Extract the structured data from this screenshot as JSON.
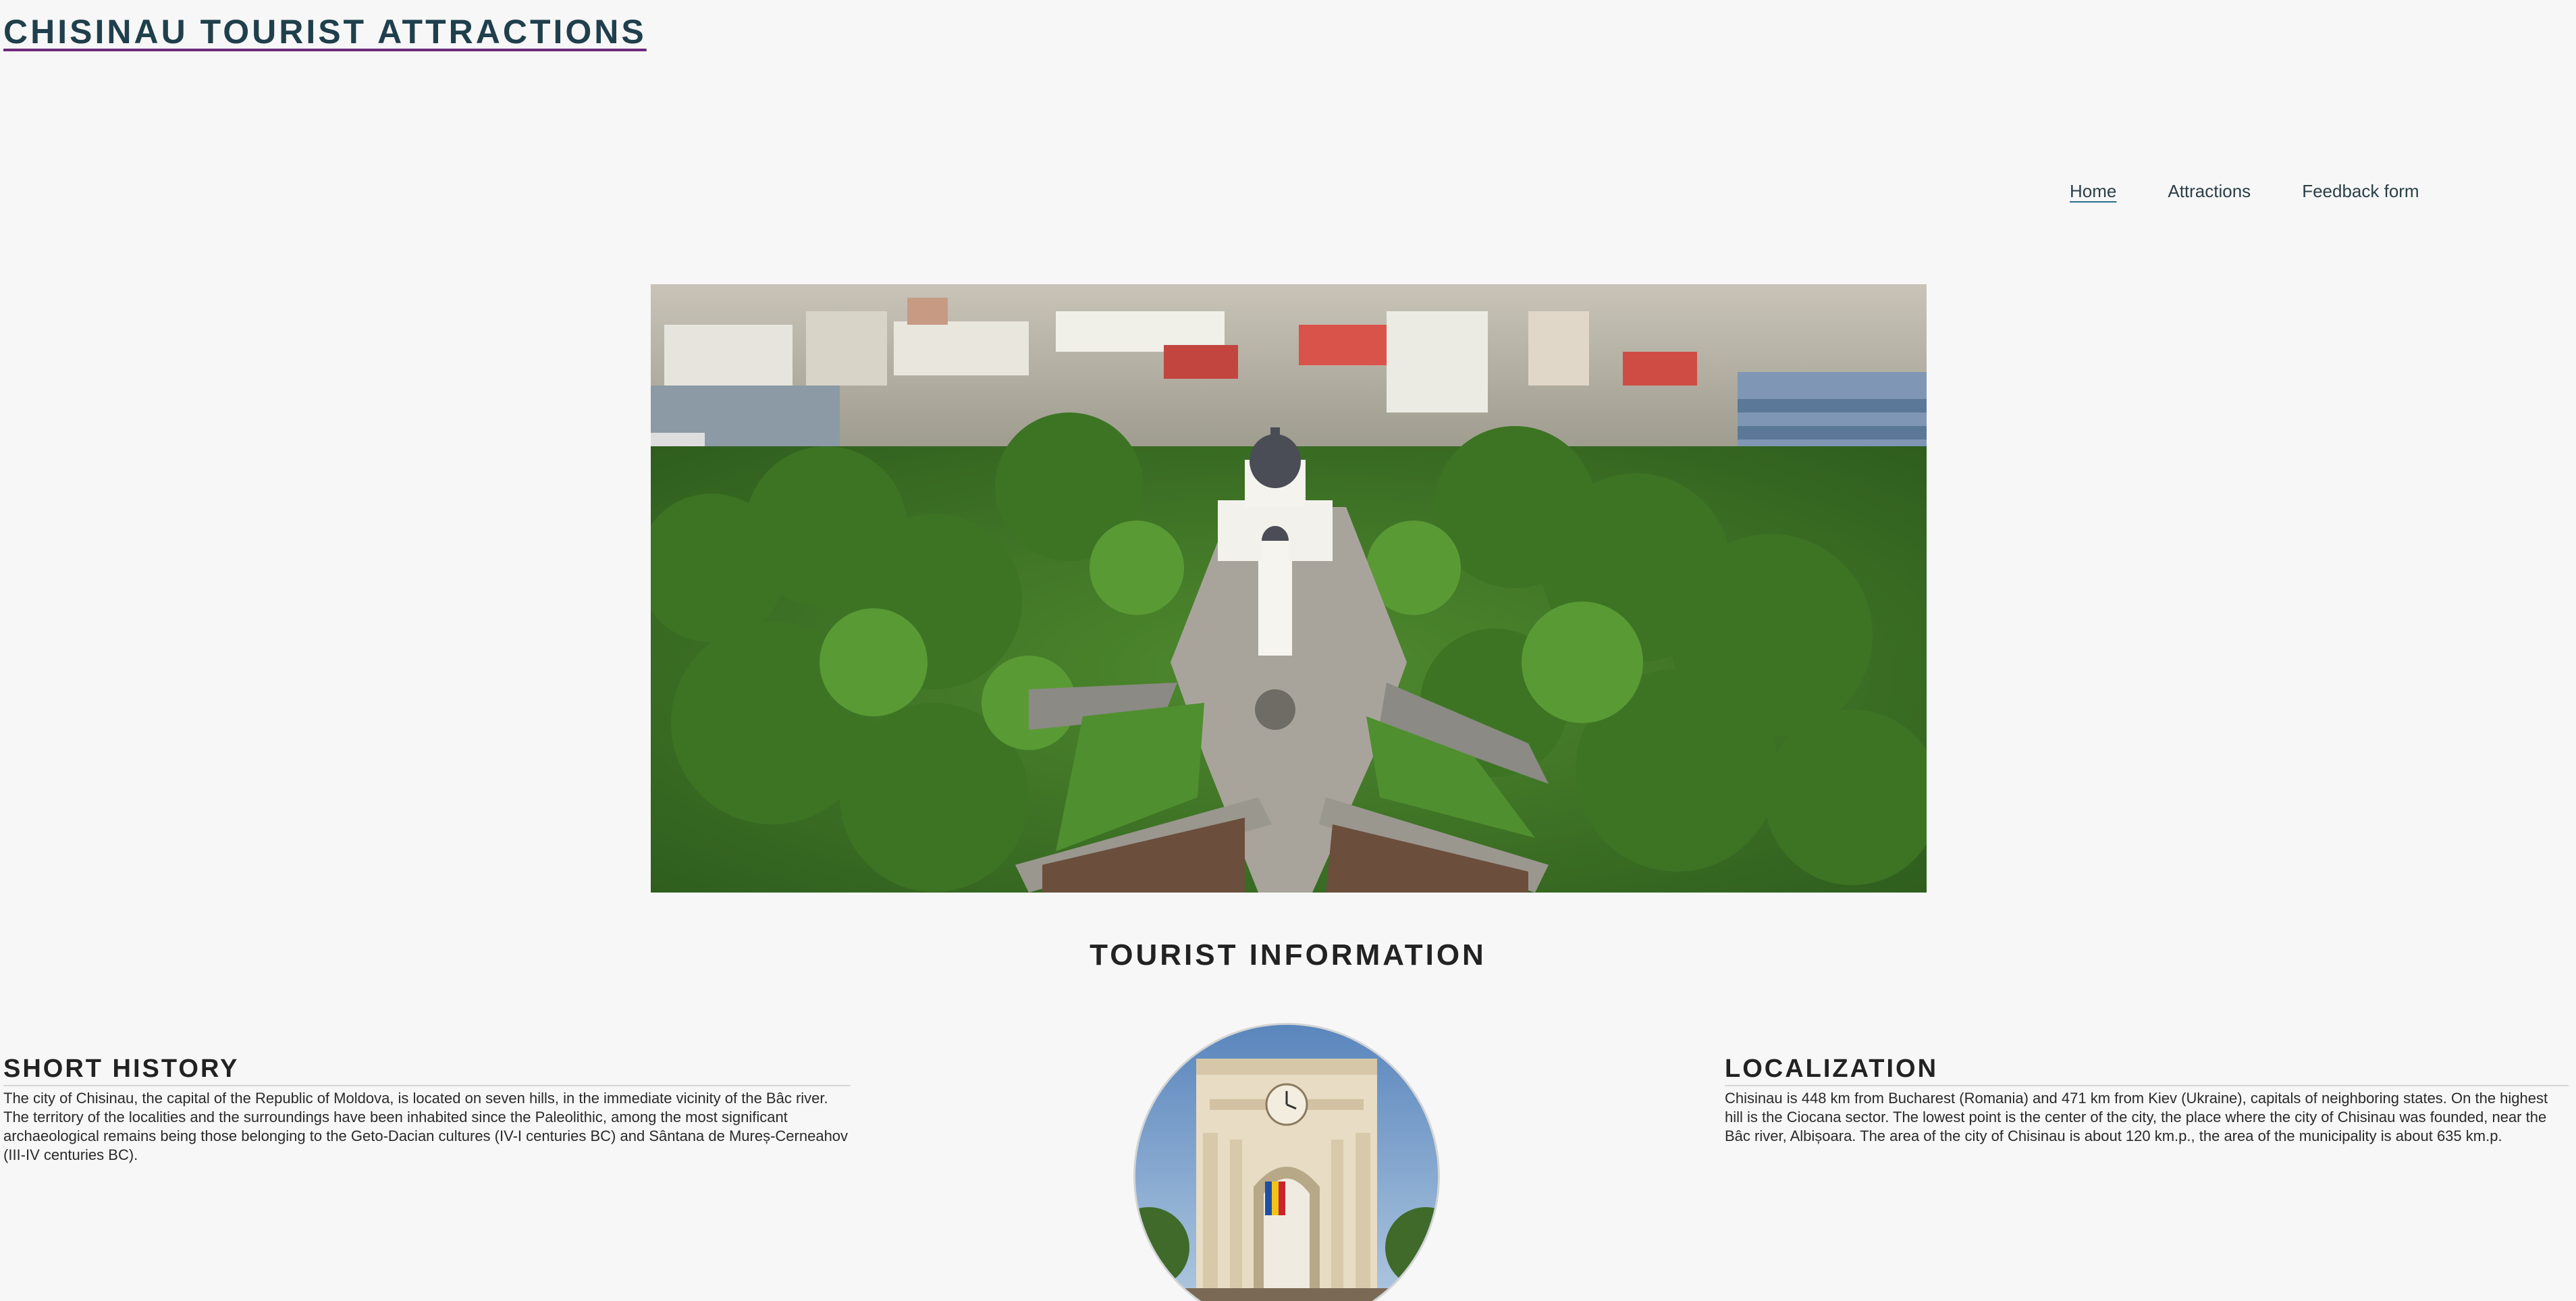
{
  "header": {
    "title": "CHISINAU TOURIST ATTRACTIONS"
  },
  "nav": {
    "items": [
      {
        "label": "Home",
        "active": true
      },
      {
        "label": "Attractions",
        "active": false
      },
      {
        "label": "Feedback form",
        "active": false
      }
    ]
  },
  "hero": {
    "image": "aerial-view-of-cathedral-park"
  },
  "main": {
    "section_title": "TOURIST INFORMATION",
    "history": {
      "heading": "SHORT HISTORY",
      "text": "The city of Chisinau, the capital of the Republic of Moldova, is located on seven hills, in the immediate vicinity of the Bâc river. The territory of the localities and the surroundings have been inhabited since the Paleolithic, among the most significant archaeological remains being those belonging to the Geto-Dacian cultures (IV-I centuries BC) and Sântana de Mureș-Cerneahov (III-IV centuries BC)."
    },
    "photo": {
      "image": "triumphal-arch-photo"
    },
    "localization": {
      "heading": "LOCALIZATION",
      "text": "Chisinau is 448 km from Bucharest (Romania) and 471 km from Kiev (Ukraine), capitals of neighboring states. On the highest hill is the Ciocana sector. The lowest point is the center of the city, the place where the city of Chisinau was founded, near the Bâc river, Albișoara. The area of the city of Chisinau is about 120 km.p., the area of the municipality is about 635 km.p."
    }
  },
  "colors": {
    "background": "#f7f7f7",
    "title": "#1f3f4c",
    "title_underline": "#6b2a7a",
    "text": "#222222"
  }
}
